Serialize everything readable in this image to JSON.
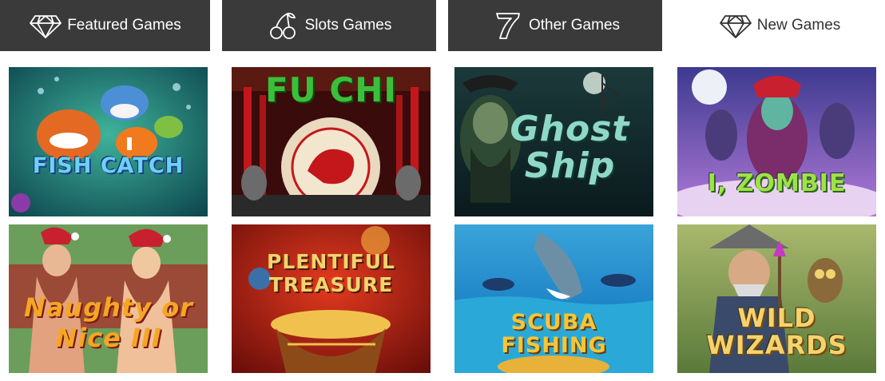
{
  "tabs": [
    {
      "label": "Featured Games",
      "icon": "diamond-icon",
      "active": false
    },
    {
      "label": "Slots Games",
      "icon": "cherries-icon",
      "active": false
    },
    {
      "label": "Other Games",
      "icon": "seven-icon",
      "active": false
    },
    {
      "label": "New Games",
      "icon": "diamond-icon",
      "active": true
    }
  ],
  "games": [
    {
      "title": "FISH CATCH"
    },
    {
      "title": "FU CHI"
    },
    {
      "title": "Ghost Ship"
    },
    {
      "title": "I, ZOMBIE"
    },
    {
      "title": "Naughty or Nice III"
    },
    {
      "title": "PLENTIFUL TREASURE"
    },
    {
      "title": "SCUBA FISHING"
    },
    {
      "title": "WILD WIZARDS"
    }
  ],
  "colors": {
    "tab_bg": "#3a3a3a",
    "tab_active_bg": "#ffffff",
    "tab_text": "#ffffff",
    "tab_active_text": "#333333"
  }
}
